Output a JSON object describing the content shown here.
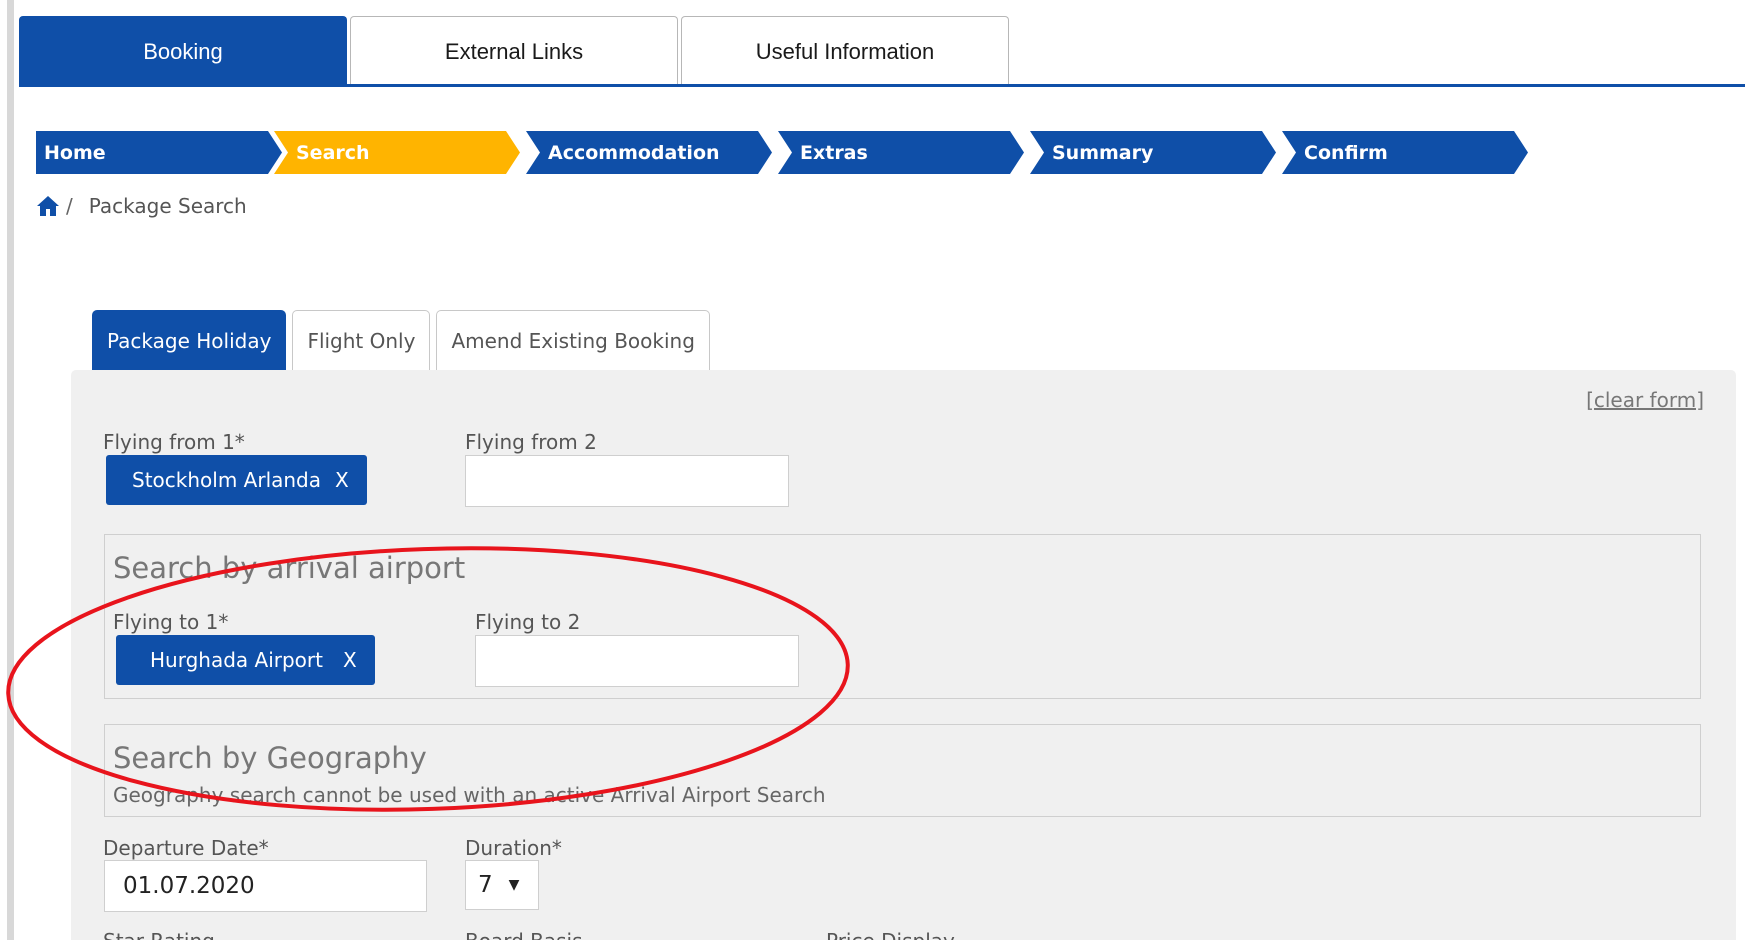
{
  "top_tabs": [
    {
      "label": "Booking"
    },
    {
      "label": "External Links"
    },
    {
      "label": "Useful Information"
    }
  ],
  "steps": [
    {
      "label": "Home",
      "color": "#0f4fa8"
    },
    {
      "label": "Search",
      "color": "#ffb400"
    },
    {
      "label": "Accommodation",
      "color": "#0f4fa8"
    },
    {
      "label": "Extras",
      "color": "#0f4fa8"
    },
    {
      "label": "Summary",
      "color": "#0f4fa8"
    },
    {
      "label": "Confirm",
      "color": "#0f4fa8"
    }
  ],
  "breadcrumb": {
    "separator": "/",
    "current": "Package Search"
  },
  "search_tabs": [
    {
      "label": "Package Holiday"
    },
    {
      "label": "Flight Only"
    },
    {
      "label": "Amend Existing Booking"
    }
  ],
  "form": {
    "clear_form": "[clear form]",
    "flying_from_1": {
      "label": "Flying from 1*",
      "chip": "Stockholm Arlanda",
      "remove": "X"
    },
    "flying_from_2": {
      "label": "Flying from 2",
      "value": ""
    },
    "arrival": {
      "legend": "Search by arrival airport",
      "flying_to_1": {
        "label": "Flying to 1*",
        "chip": "Hurghada Airport",
        "remove": "X"
      },
      "flying_to_2": {
        "label": "Flying to 2",
        "value": ""
      }
    },
    "geography": {
      "legend": "Search by Geography",
      "note": "Geography search cannot be used with an active Arrival Airport Search"
    },
    "departure_date": {
      "label": "Departure Date*",
      "value": "01.07.2020"
    },
    "duration": {
      "label": "Duration*",
      "value": "7"
    },
    "cut_labels": {
      "star_rating": "Star Rating",
      "board_basis": "Board Basis",
      "price_display": "Price Display"
    }
  },
  "colors": {
    "brand_blue": "#0f4fa8",
    "active_step": "#ffb400",
    "annotation_red": "#e8141c"
  }
}
